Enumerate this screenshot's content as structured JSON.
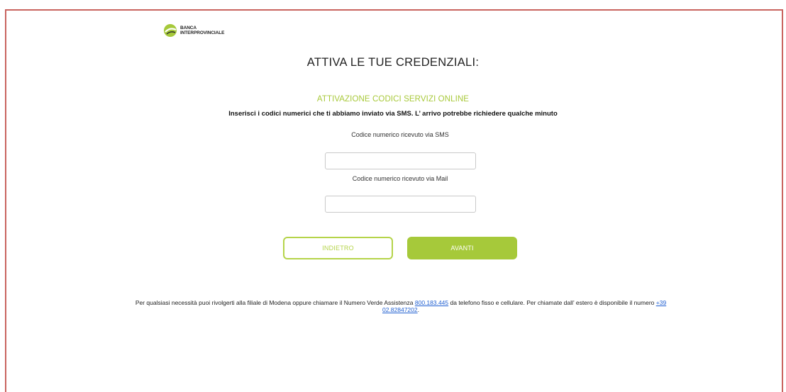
{
  "brand": {
    "logo_line1": "BANCA",
    "logo_line2": "INTERPROVINCIALE",
    "accent_color": "#a6c93a",
    "frame_color": "#c9645f"
  },
  "page": {
    "title": "ATTIVA LE TUE CREDENZIALI:",
    "subtitle": "ATTIVAZIONE CODICI SERVIZI ONLINE",
    "instructions": "Inserisci i codici numerici che ti abbiamo inviato via SMS. L’ arrivo potrebbe richiedere qualche minuto"
  },
  "form": {
    "sms_label": "Codice numerico ricevuto via SMS",
    "sms_value": "",
    "mail_label": "Codice numerico ricevuto via Mail",
    "mail_value": ""
  },
  "buttons": {
    "back_label": "INDIETRO",
    "next_label": "AVANTI"
  },
  "footer": {
    "text_part1": "Per qualsiasi necessità puoi rivolgerti alla filiale di Modena oppure chiamare il Numero Verde Assistenza ",
    "toll_free_number": "800.183.445",
    "text_part2": " da telefono fisso e cellulare. Per chiamate dall’ estero è disponibile il numero ",
    "international_number": "+39 02.82847202",
    "text_part3": "."
  }
}
